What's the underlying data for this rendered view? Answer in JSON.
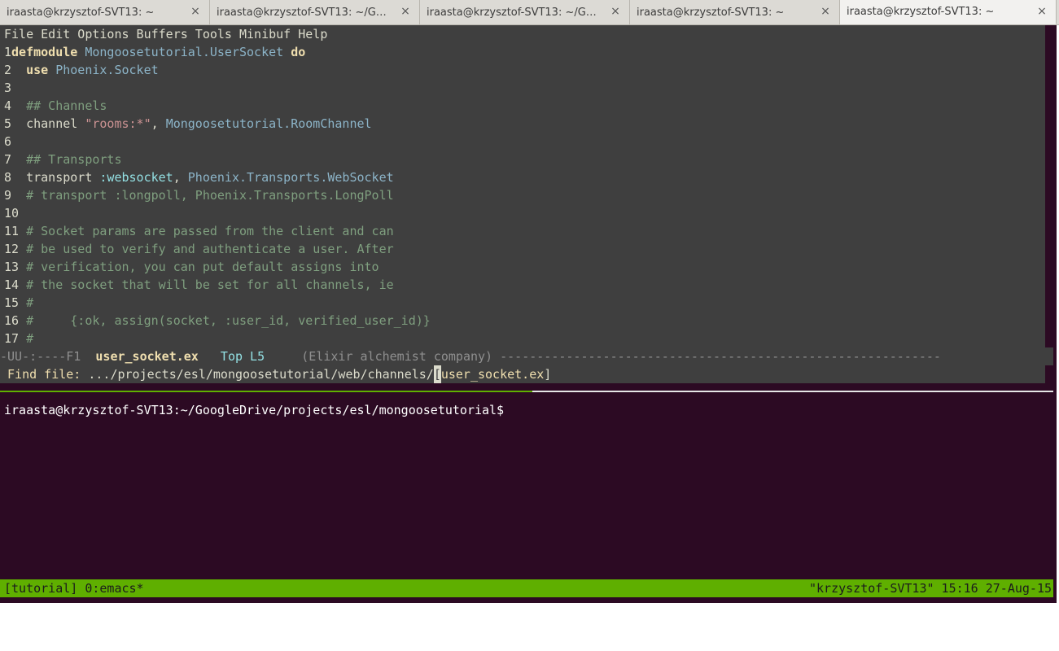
{
  "tabs": [
    {
      "label": "iraasta@krzysztof-SVT13: ~",
      "close": "×"
    },
    {
      "label": "iraasta@krzysztof-SVT13: ~/G…",
      "close": "×"
    },
    {
      "label": "iraasta@krzysztof-SVT13: ~/G…",
      "close": "×"
    },
    {
      "label": "iraasta@krzysztof-SVT13: ~",
      "close": "×"
    },
    {
      "label": "iraasta@krzysztof-SVT13: ~",
      "close": "×"
    }
  ],
  "menubar": "File Edit Options Buffers Tools Minibuf Help",
  "code": {
    "l1": {
      "n": "1",
      "kw": "defmodule",
      "mod": " Mongoosetutorial.UserSocket ",
      "kw2": "do"
    },
    "l2": {
      "n": "2",
      "kw": "use",
      "mod": " Phoenix.Socket"
    },
    "l3": {
      "n": "3"
    },
    "l4": {
      "n": "4",
      "com": "## Channels"
    },
    "l5": {
      "n": "5",
      "plain": "channel ",
      "str": "\"rooms:*\"",
      "plain2": ", ",
      "mod": "Mongoosetutorial.RoomChannel"
    },
    "l6": {
      "n": "6"
    },
    "l7": {
      "n": "7",
      "com": "## Transports"
    },
    "l8": {
      "n": "8",
      "plain": "transport ",
      "atom": ":websocket",
      "plain2": ", ",
      "mod": "Phoenix.Transports.WebSocket"
    },
    "l9": {
      "n": "9",
      "com": "# transport :longpoll, Phoenix.Transports.LongPoll"
    },
    "l10": {
      "n": "10"
    },
    "l11": {
      "n": "11",
      "com": "# Socket params are passed from the client and can"
    },
    "l12": {
      "n": "12",
      "com": "# be used to verify and authenticate a user. After"
    },
    "l13": {
      "n": "13",
      "com": "# verification, you can put default assigns into"
    },
    "l14": {
      "n": "14",
      "com": "# the socket that will be set for all channels, ie"
    },
    "l15": {
      "n": "15",
      "com": "#"
    },
    "l16": {
      "n": "16",
      "com": "#     {:ok, assign(socket, :user_id, verified_user_id)}"
    },
    "l17": {
      "n": "17",
      "com": "#"
    }
  },
  "modeline": {
    "prefix": "-UU-:----F1  ",
    "buffer": "user_socket.ex",
    "position": "   Top L5     ",
    "modes": "(Elixir alchemist company) ------------------------------------------------------------"
  },
  "minibuffer": {
    "prompt": "Find file: ",
    "path": ".../projects/esl/mongoosetutorial/web/channels/",
    "cursor": "[",
    "completion": "user_socket.ex",
    "close": "]"
  },
  "shell_prompt": "iraasta@krzysztof-SVT13:~/GoogleDrive/projects/esl/mongoosetutorial$",
  "tmux_status": {
    "left": "[tutorial] 0:emacs*",
    "right": "\"krzysztof-SVT13\" 15:16 27-Aug-15"
  },
  "colors": {
    "terminal_bg": "#2c0a23",
    "emacs_bg": "#3f3f3f",
    "tmux_green": "#5faf00"
  }
}
